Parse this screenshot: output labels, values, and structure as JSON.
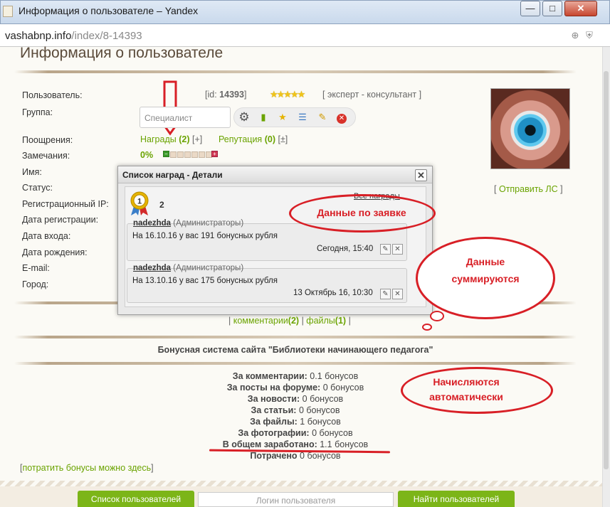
{
  "window": {
    "title": "Информация о пользователе – Yandex",
    "min": "—",
    "max": "□",
    "close": "✕"
  },
  "address": {
    "host": "vashabnp.info",
    "path": "/index/8-14393"
  },
  "page": {
    "title": "Информация о пользователе"
  },
  "profile": {
    "labels": {
      "user": "Пользователь:",
      "group": "Группа:",
      "rewards": "Поощрения:",
      "remarks": "Замечания:",
      "name": "Имя:",
      "status": "Статус:",
      "reg_ip": "Регистрационный IP:",
      "reg_date": "Дата регистрации:",
      "login_date": "Дата входа:",
      "birthday": "Дата рождения:",
      "email": "E-mail:",
      "city": "Город:"
    },
    "id_prefix": "[id:",
    "id": "14393",
    "id_suffix": "]",
    "rank": "[ эксперт - консультант ]",
    "stars": "★★★★★",
    "group_value": "Специалист",
    "awards_text": "Награды",
    "awards_count": "(2)",
    "awards_plus": "[+]",
    "reputation_text": "Репутация",
    "reputation_count": "(0)",
    "reputation_pm": "[±]",
    "remarks_value": "0%",
    "send_pm": "Отправить ЛС",
    "bracket_open": "[",
    "bracket_close": "]"
  },
  "dialog": {
    "title": "Список наград - Детали",
    "close": "✕",
    "medal_num": "1",
    "count": "2",
    "all_awards": "Все награды",
    "entries": [
      {
        "author": "nadezhda",
        "role": "(Администраторы)",
        "text": "На 16.10.16 у вас 191 бонусных рубля",
        "time": "Сегодня, 15:40"
      },
      {
        "author": "nadezhda",
        "role": "(Администраторы)",
        "text": "На 13.10.16 у вас 175 бонусных рубля",
        "time": "13 Октябрь 16, 10:30"
      }
    ]
  },
  "annotations": {
    "by_request": "Данные  по заявке",
    "summed_1": "Данные",
    "summed_2": "суммируются",
    "auto_1": "Начисляются",
    "auto_2": "автоматически"
  },
  "links_bar": {
    "comments": "комментарии",
    "comments_count": "(2)",
    "files": "файлы",
    "files_count": "(1)",
    "sep": "|"
  },
  "bonus": {
    "title": "Бонусная система сайта \"Библиотеки начинающего педагога\"",
    "rows": [
      {
        "label": "За комментарии:",
        "value": "0.1 бонусов"
      },
      {
        "label": "За посты на форуме:",
        "value": "0 бонусов"
      },
      {
        "label": "За новости:",
        "value": "0 бонусов"
      },
      {
        "label": "За статьи:",
        "value": "0 бонусов"
      },
      {
        "label": "За файлы:",
        "value": "1 бонусов"
      },
      {
        "label": "За фотографии:",
        "value": "0 бонусов"
      },
      {
        "label": "В общем заработано:",
        "value": "1.1 бонусов"
      },
      {
        "label": "Потрачено",
        "value": "0 бонусов"
      }
    ],
    "spend_link": "потратить бонусы можно здесь"
  },
  "bottom": {
    "list_btn": "Список пользователей",
    "login_placeholder": "Логин пользователя",
    "find_btn": "Найти пользователей"
  },
  "colors": {
    "accent_green": "#6aa300",
    "annotation_red": "#d81f26"
  }
}
